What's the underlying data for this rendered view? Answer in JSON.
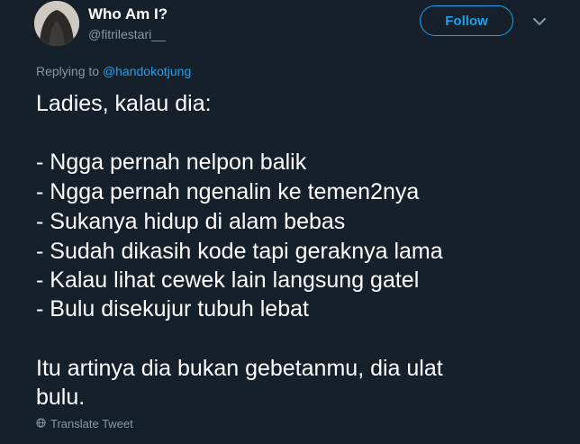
{
  "user": {
    "display_name": "Who Am I?",
    "handle": "@fitrilestari__"
  },
  "actions": {
    "follow_label": "Follow"
  },
  "icons": {
    "more": "chevron-down-icon",
    "translate": "globe-icon"
  },
  "reply": {
    "prefix": "Replying to ",
    "mention": "@handokotjung"
  },
  "tweet": {
    "intro": "Ladies, kalau dia:",
    "items": [
      "- Ngga pernah nelpon balik",
      "- Ngga pernah ngenalin ke temen2nya",
      "- Sukanya hidup di alam bebas",
      "- Sudah dikasih kode tapi geraknya lama",
      "- Kalau lihat cewek lain langsung gatel",
      "- Bulu disekujur tubuh lebat"
    ],
    "conclusion_lines": [
      "Itu artinya dia bukan gebetanmu, dia ulat",
      "bulu."
    ]
  },
  "translate_label": "Translate Tweet",
  "colors": {
    "background": "#15202b",
    "accent": "#1da1f2",
    "secondary_text": "#8899a6",
    "primary_text": "#ffffff"
  }
}
